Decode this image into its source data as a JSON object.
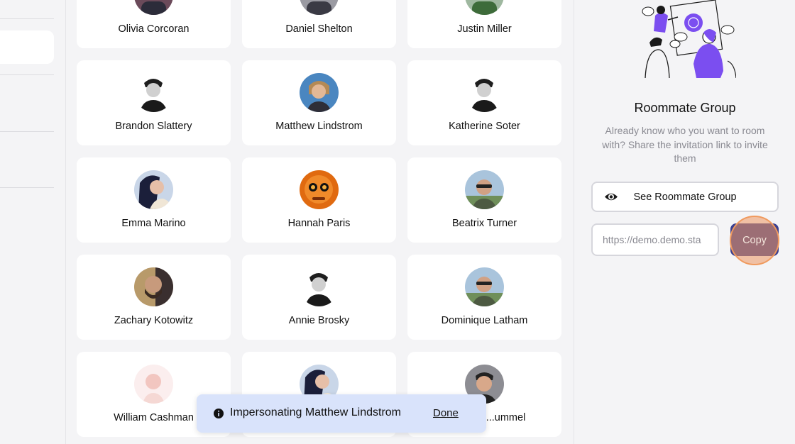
{
  "people": [
    {
      "name": "Olivia Corcoran",
      "avatar": "avatar-photo-woman"
    },
    {
      "name": "Daniel Shelton",
      "avatar": "avatar-photo-man"
    },
    {
      "name": "Justin Miller",
      "avatar": "avatar-photo-man-green"
    },
    {
      "name": "Brandon Slattery",
      "avatar": "avatar-photo-man-bw"
    },
    {
      "name": "Matthew Lindstrom",
      "avatar": "avatar-photo-woman-blue"
    },
    {
      "name": "Katherine Soter",
      "avatar": "avatar-photo-man-bw"
    },
    {
      "name": "Emma Marino",
      "avatar": "avatar-photo-woman-dark-hair"
    },
    {
      "name": "Hannah Paris",
      "avatar": "avatar-photo-orange"
    },
    {
      "name": "Beatrix Turner",
      "avatar": "avatar-photo-man-sunglasses"
    },
    {
      "name": "Zachary Kotowitz",
      "avatar": "avatar-photo-man-beard"
    },
    {
      "name": "Annie Brosky",
      "avatar": "avatar-photo-man-bw"
    },
    {
      "name": "Dominique Latham",
      "avatar": "avatar-photo-man-sunglasses"
    },
    {
      "name": "William Cashman",
      "avatar": "avatar-photo-faded"
    },
    {
      "name": "",
      "avatar": "avatar-photo-woman-dark-hair"
    },
    {
      "name": "...ummel",
      "avatar": "avatar-photo-man-smiling"
    }
  ],
  "panel": {
    "title": "Roommate Group",
    "description": "Already know who you want to room with? Share the invitation link to invite them",
    "see_button_label": "See Roommate Group",
    "invite_link_value": "https://demo.demo.sta",
    "copy_button_label": "Copy",
    "illustration": "people-brainstorm-illustration"
  },
  "toast": {
    "icon": "info-icon",
    "message": "Impersonating Matthew Lindstrom",
    "done_label": "Done"
  },
  "colors": {
    "background": "#f4f4f6",
    "card": "#ffffff",
    "primary": "#3b3f8f",
    "highlight": "#f09a5e",
    "toast_bg": "#d9e3fb",
    "muted_text": "#8a8a92"
  }
}
